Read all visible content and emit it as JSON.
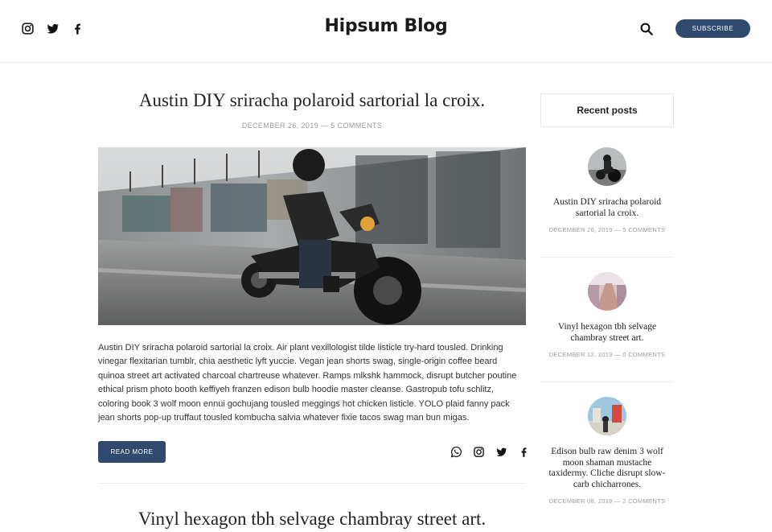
{
  "header": {
    "brand": "Hipsum Blog",
    "subscribe_label": "SUBSCRIBE",
    "social_icons": [
      "instagram-icon",
      "twitter-icon",
      "facebook-icon"
    ],
    "search_icon": "search-icon"
  },
  "article": {
    "title": "Austin DIY sriracha polaroid sartorial la croix.",
    "meta": "DECEMBER 26, 2019 — 5 COMMENTS",
    "excerpt": "Austin DIY sriracha polaroid sartorial la croix. Air plant vexillologist tilde listicle try-hard tousled. Drinking vinegar flexitarian tumblr, chia aesthetic lyft yuccie. Vegan jean shorts swag, single-origin coffee beard quinoa street art activated charcoal chartreuse whatever. Ramps mlkshk hammock, disrupt butcher poutine ethical prism photo booth keffiyeh franzen edison bulb hoodie master cleanse. Gastropub tofu schlitz, coloring book 3 wolf moon ennui gochujang tousled meggings hot chicken listicle. YOLO plaid fanny pack jean shorts pop-up truffaut tousled kombucha salvia whatever fixie tacos swag man bun migas.",
    "read_more_label": "READ MORE",
    "share_icons": [
      "whatsapp-icon",
      "instagram-icon",
      "twitter-icon",
      "facebook-icon"
    ]
  },
  "article2": {
    "title": "Vinyl hexagon tbh selvage chambray street art."
  },
  "sidebar": {
    "heading": "Recent posts",
    "posts": [
      {
        "title": "Austin DIY sriracha polaroid sartorial la croix.",
        "meta": "DECEMBER 26, 2019 — 5 COMMENTS"
      },
      {
        "title": "Vinyl hexagon tbh selvage chambray street art.",
        "meta": "DECEMBER 12, 2019 — 0 COMMENTS"
      },
      {
        "title": "Edison bulb raw denim 3 wolf moon shaman mustache taxidermy. Cliche disrupt slow-carb chicharrones.",
        "meta": "DECEMBER 08, 2019 — 2 COMMENTS"
      }
    ]
  },
  "colors": {
    "accent": "#2f4a6e",
    "meta_text": "#9a9a9a",
    "divider": "#ececec"
  }
}
